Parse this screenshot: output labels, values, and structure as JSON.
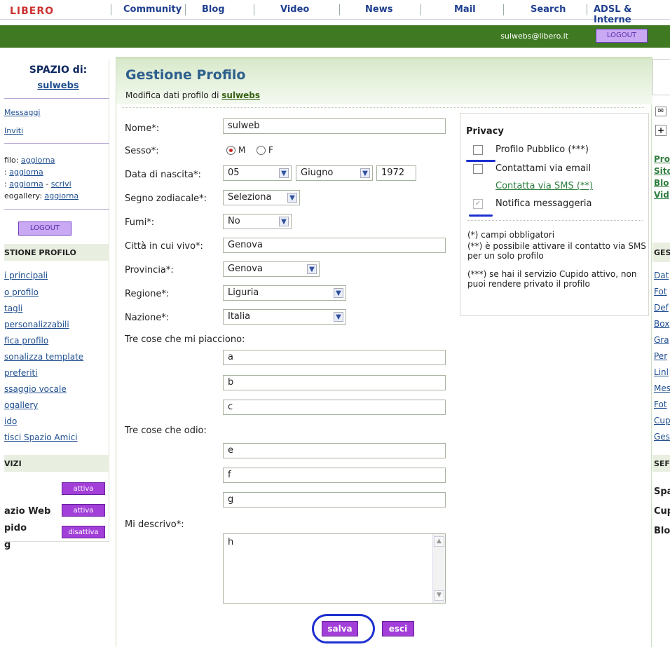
{
  "topnav": {
    "logo_text": "LIBERO",
    "tabs": [
      "Community",
      "Blog",
      "Video",
      "News",
      "Mail",
      "Search",
      "ADSL & Interne"
    ]
  },
  "header": {
    "user_email": "sulwebs@libero.it",
    "logout_label": "LOGOUT"
  },
  "leftcol": {
    "title": "SPAZIO di:",
    "username": "sulwebs",
    "links_top": [
      "Messaggi",
      "Inviti"
    ],
    "profile_links": [
      {
        "prefix": "filo",
        "link": "aggiorna"
      },
      {
        "prefix": ":",
        "link": "aggiorna"
      },
      {
        "prefix": ":",
        "link": "aggiorna",
        "link2": "scrivi"
      },
      {
        "prefix": "eogallery",
        "link": "aggiorna"
      }
    ],
    "logout_label": "LOGOUT",
    "section_head": "STIONE PROFILO",
    "nav": [
      "i principali",
      "o profilo",
      "tagli",
      "personalizzabili",
      "fica profilo",
      "sonalizza template",
      "preferiti",
      "ssaggio vocale",
      "ogallery",
      "ido",
      "tisci Spazio Amici"
    ],
    "services_head": "VIZI",
    "services": [
      {
        "name": "azio Web",
        "button": "attiva"
      },
      {
        "name": "pido",
        "button": "attiva"
      },
      {
        "name": "g",
        "button": "disattiva"
      }
    ]
  },
  "main": {
    "title": "Gestione Profilo",
    "subtitle_prefix": "Modifica dati profilo di",
    "subtitle_user": "sulwebs",
    "form": {
      "nome_label": "Nome*:",
      "nome_value": "sulweb",
      "sesso_label": "Sesso*:",
      "sesso_m": "M",
      "sesso_f": "F",
      "data_label": "Data di nascita*:",
      "day": "05",
      "month": "Giugno",
      "year": "1972",
      "segno_label": "Segno zodiacale*:",
      "segno_value": "Seleziona",
      "fumi_label": "Fumi*:",
      "fumi_value": "No",
      "citta_label": "Città in cui vivo*:",
      "citta_value": "Genova",
      "provincia_label": "Provincia*:",
      "provincia_value": "Genova",
      "regione_label": "Regione*:",
      "regione_value": "Liguria",
      "nazione_label": "Nazione*:",
      "nazione_value": "Italia",
      "piacciono_label": "Tre cose che mi piacciono:",
      "piacciono": [
        "a",
        "b",
        "c"
      ],
      "odio_label": "Tre cose che odio:",
      "odio": [
        "e",
        "f",
        "g"
      ],
      "descrivo_label": "Mi descrivo*:",
      "descrivo_value": "h",
      "save_label": "salva",
      "exit_label": "esci"
    },
    "privacy": {
      "head": "Privacy",
      "opt_pubblico": "Profilo Pubblico (***)",
      "opt_email": "Contattami via email",
      "opt_sms": "Contatta via SMS (**)",
      "opt_notifica": "Notifica messaggeria",
      "note1": "(*) campi obbligatori",
      "note2": "(**) è possibile attivare il contatto via SMS per un solo profilo",
      "note3": "(***) se hai il servizio Cupido attivo, non puoi rendere privato il profilo"
    }
  },
  "rightcol": {
    "links_top": [
      "Pro",
      "Sito",
      "Blo",
      "Vid"
    ],
    "section_head": "GES",
    "nav": [
      "Dat",
      "Fot",
      "Def",
      "Box",
      "Gra",
      "Per",
      "Linl",
      "Mes",
      "Fot",
      "Cup",
      "Ges"
    ],
    "services_head": "SEF",
    "services": [
      "Spa",
      "Cup",
      "Blo"
    ]
  },
  "colors": {
    "brand_green": "#3f7a22",
    "title_blue": "#2d5f8c",
    "button_purple": "#a23fd8",
    "annotation_blue": "#1d2fcf"
  }
}
